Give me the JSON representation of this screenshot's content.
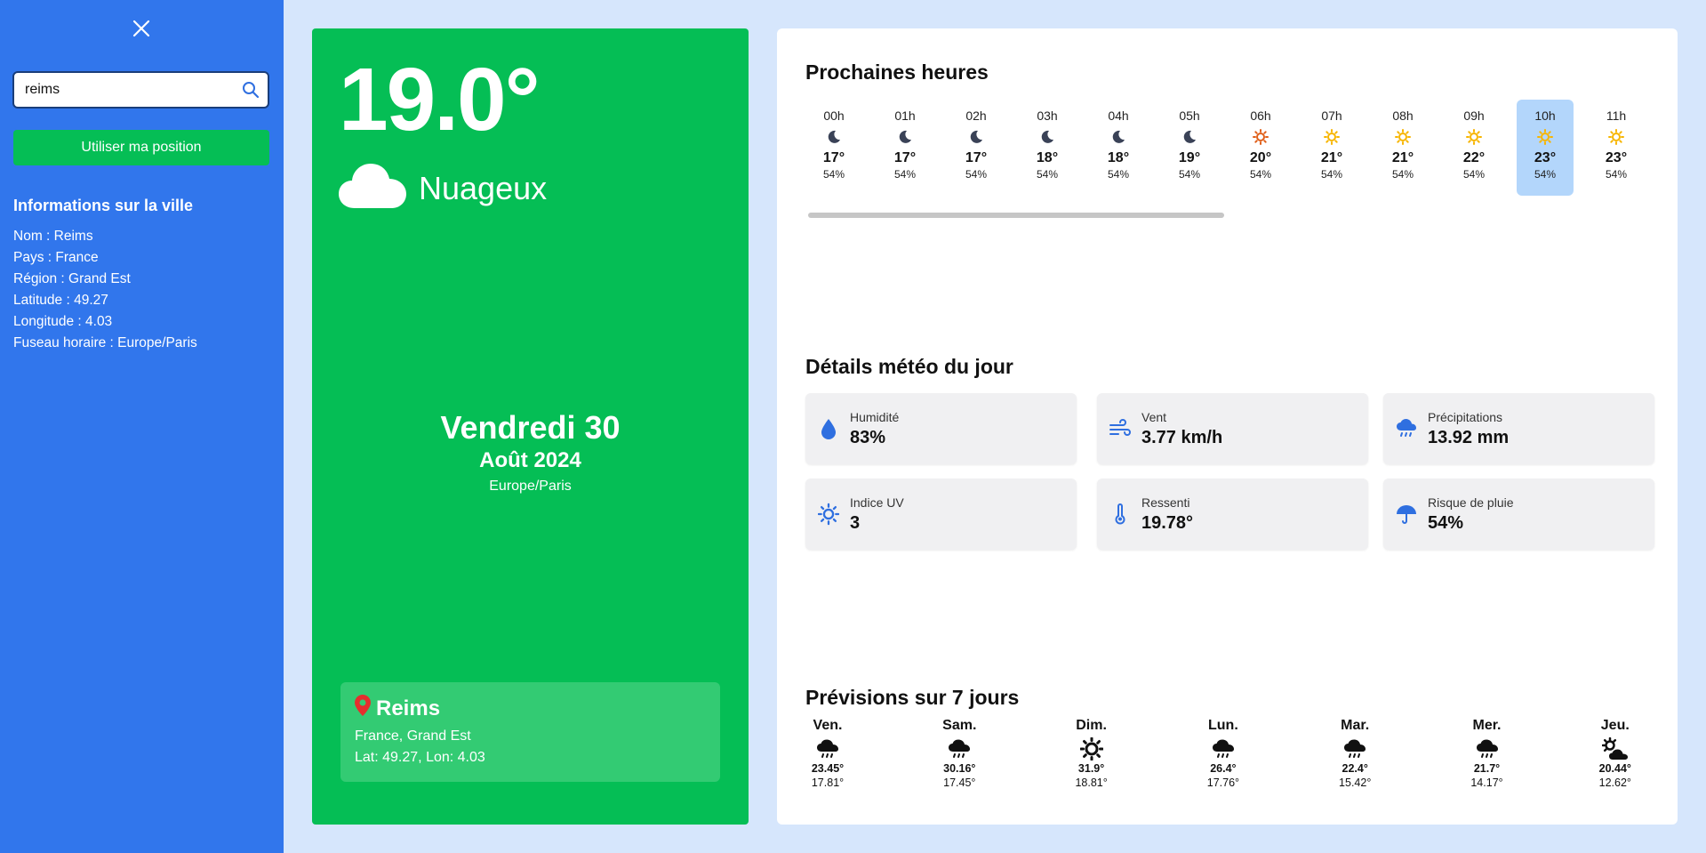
{
  "search": {
    "value": "reims"
  },
  "sidebar": {
    "use_position_label": "Utiliser ma position",
    "info_title": "Informations sur la ville",
    "info_lines": [
      "Nom : Reims",
      "Pays : France",
      "Région : Grand Est",
      "Latitude : 49.27",
      "Longitude : 4.03",
      "Fuseau horaire : Europe/Paris"
    ]
  },
  "current": {
    "temperature": "19.0°",
    "condition": "Nuageux",
    "day": "Vendredi 30",
    "month": "Août 2024",
    "timezone": "Europe/Paris",
    "city": "Reims",
    "region": "France, Grand Est",
    "coords": "Lat: 49.27, Lon: 4.03"
  },
  "hourly": {
    "title": "Prochaines heures",
    "hours": [
      {
        "hour": "00h",
        "icon": "moon-icon",
        "temp": "17°",
        "rain": "54%"
      },
      {
        "hour": "01h",
        "icon": "moon-icon",
        "temp": "17°",
        "rain": "54%"
      },
      {
        "hour": "02h",
        "icon": "moon-icon",
        "temp": "17°",
        "rain": "54%"
      },
      {
        "hour": "03h",
        "icon": "moon-icon",
        "temp": "18°",
        "rain": "54%"
      },
      {
        "hour": "04h",
        "icon": "moon-icon",
        "temp": "18°",
        "rain": "54%"
      },
      {
        "hour": "05h",
        "icon": "moon-icon",
        "temp": "19°",
        "rain": "54%"
      },
      {
        "hour": "06h",
        "icon": "sunrise-icon",
        "temp": "20°",
        "rain": "54%"
      },
      {
        "hour": "07h",
        "icon": "sun-icon",
        "temp": "21°",
        "rain": "54%"
      },
      {
        "hour": "08h",
        "icon": "sun-icon",
        "temp": "21°",
        "rain": "54%"
      },
      {
        "hour": "09h",
        "icon": "sun-icon",
        "temp": "22°",
        "rain": "54%"
      },
      {
        "hour": "10h",
        "icon": "sun-icon",
        "temp": "23°",
        "rain": "54%"
      },
      {
        "hour": "11h",
        "icon": "sun-icon",
        "temp": "23°",
        "rain": "54%"
      }
    ],
    "active_index": 10
  },
  "details": {
    "title": "Détails météo du jour",
    "items": [
      {
        "label": "Humidité",
        "value": "83%",
        "icon": "droplet-icon"
      },
      {
        "label": "Vent",
        "value": "3.77 km/h",
        "icon": "wind-icon"
      },
      {
        "label": "Précipitations",
        "value": "13.92 mm",
        "icon": "rain-cloud-icon"
      },
      {
        "label": "Indice UV",
        "value": "3",
        "icon": "sun-icon"
      },
      {
        "label": "Ressenti",
        "value": "19.78°",
        "icon": "thermometer-icon"
      },
      {
        "label": "Risque de pluie",
        "value": "54%",
        "icon": "umbrella-icon"
      }
    ]
  },
  "forecast": {
    "title": "Prévisions sur 7 jours",
    "days": [
      {
        "day": "Ven.",
        "icon": "rain-cloud-icon",
        "max": "23.45°",
        "min": "17.81°"
      },
      {
        "day": "Sam.",
        "icon": "rain-cloud-icon",
        "max": "30.16°",
        "min": "17.45°"
      },
      {
        "day": "Dim.",
        "icon": "sun-icon",
        "max": "31.9°",
        "min": "18.81°"
      },
      {
        "day": "Lun.",
        "icon": "rain-cloud-icon",
        "max": "26.4°",
        "min": "17.76°"
      },
      {
        "day": "Mar.",
        "icon": "rain-cloud-icon",
        "max": "22.4°",
        "min": "15.42°"
      },
      {
        "day": "Mer.",
        "icon": "rain-cloud-icon",
        "max": "21.7°",
        "min": "14.17°"
      },
      {
        "day": "Jeu.",
        "icon": "sun-cloud-icon",
        "max": "20.44°",
        "min": "12.62°"
      }
    ]
  },
  "colors": {
    "sidebar": "#3176ec",
    "card_green": "#05be55",
    "accent_blue": "#2f6fe0",
    "sun": "#f7b500",
    "sunrise": "#e0601a",
    "moon": "#3a4257",
    "active_hour": "#b3d6fb"
  }
}
